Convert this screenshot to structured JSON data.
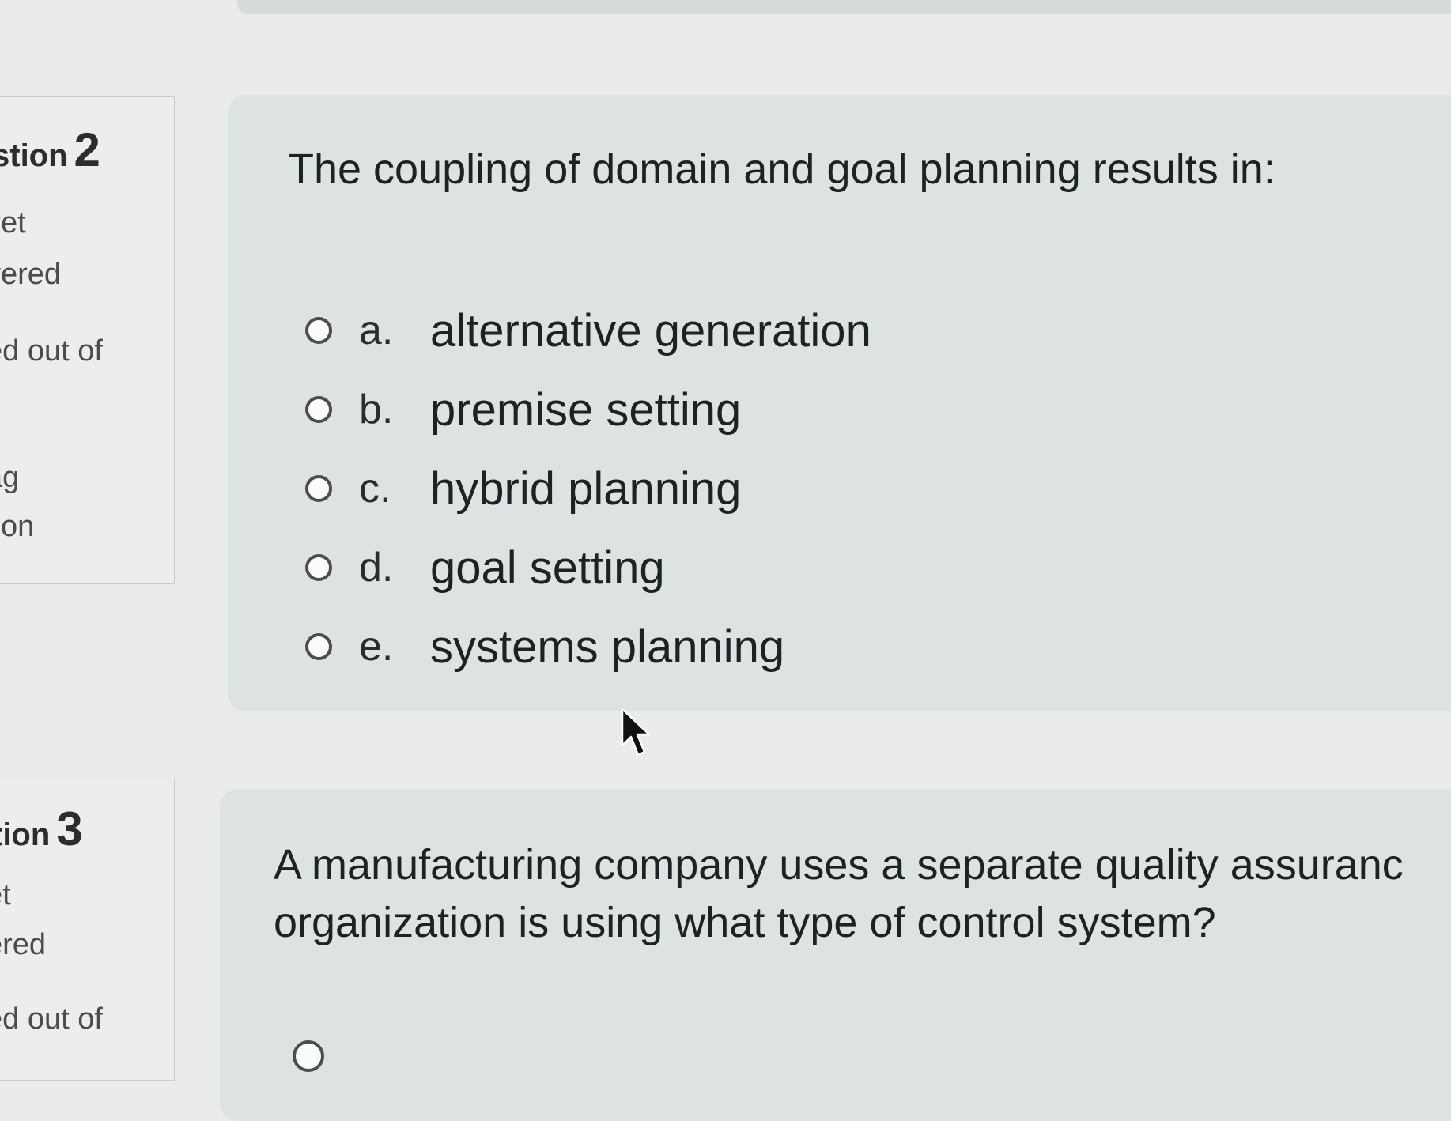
{
  "question2": {
    "info": {
      "title": "stion",
      "number": "2",
      "status_line1": "yet",
      "status_line2": "vered",
      "marks_line": "ed out of",
      "flag_line1": "ag",
      "flag_line2": "tion"
    },
    "text": "The coupling of domain and goal planning results in:",
    "options": [
      {
        "letter": "a.",
        "text": "alternative generation"
      },
      {
        "letter": "b.",
        "text": "premise setting"
      },
      {
        "letter": "c.",
        "text": "hybrid planning"
      },
      {
        "letter": "d.",
        "text": "goal setting"
      },
      {
        "letter": "e.",
        "text": "systems planning"
      }
    ]
  },
  "question3": {
    "info": {
      "title": "tion",
      "number": "3",
      "status_line1": "et",
      "status_line2": "ered",
      "marks_line": "ed out of"
    },
    "text_line1": "A manufacturing company uses a separate quality assuranc",
    "text_line2": "organization is using what type of control system?"
  },
  "icons": {
    "cursor": "mouse-pointer-icon",
    "radio": "radio-button-icon"
  }
}
